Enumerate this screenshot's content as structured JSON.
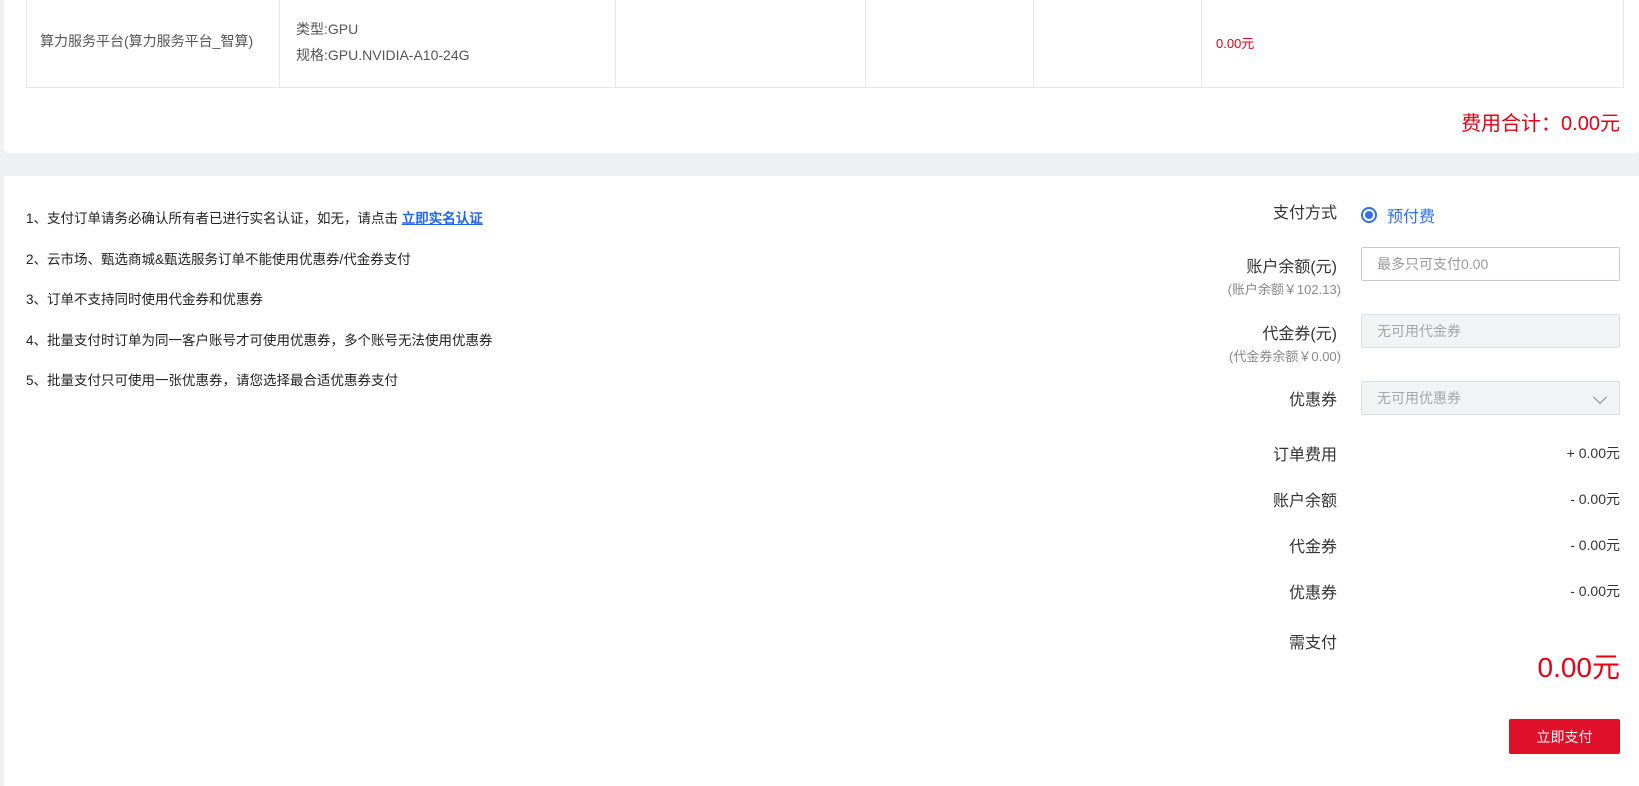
{
  "order_table": {
    "row": {
      "product": "算力服务平台(算力服务平台_智算)",
      "spec_type": "类型:GPU",
      "spec_model": "规格:GPU.NVIDIA-A10-24G",
      "col3": "",
      "col4": "",
      "col5": "",
      "price": "0.00元"
    }
  },
  "total": {
    "text": "费用合计：0.00元"
  },
  "notes": {
    "n1_prefix": "1、支付订单请务必确认所有者已进行实名认证，如无，请点击 ",
    "n1_link": "立即实名认证",
    "n2": "2、云市场、甄选商城&甄选服务订单不能使用优惠券/代金券支付",
    "n3": "3、订单不支持同时使用代金券和优惠券",
    "n4": "4、批量支付时订单为同一客户账号才可使用优惠券，多个账号无法使用优惠券",
    "n5": "5、批量支付只可使用一张优惠券，请您选择最合适优惠券支付"
  },
  "payment": {
    "method_label": "支付方式",
    "method_option": "预付费",
    "balance_label": "账户余额(元)",
    "balance_sub": "(账户余额￥102.13)",
    "balance_placeholder": "最多只可支付0.00",
    "voucher_label": "代金券(元)",
    "voucher_sub": "(代金券余额￥0.00)",
    "voucher_value": "无可用代金券",
    "coupon_label": "优惠券",
    "coupon_value": "无可用优惠券"
  },
  "summary": {
    "order_fee_label": "订单费用",
    "order_fee_value": "+ 0.00元",
    "balance_label": "账户余额",
    "balance_value": "- 0.00元",
    "voucher_label": "代金券",
    "voucher_value": "- 0.00元",
    "coupon_label": "优惠券",
    "coupon_value": "- 0.00元",
    "due_label": "需支付",
    "due_value": "0.00元",
    "pay_button": "立即支付"
  },
  "colors": {
    "accent_red": "#e60012",
    "link_blue": "#2266ee",
    "radio_blue": "#2f6ff0"
  }
}
